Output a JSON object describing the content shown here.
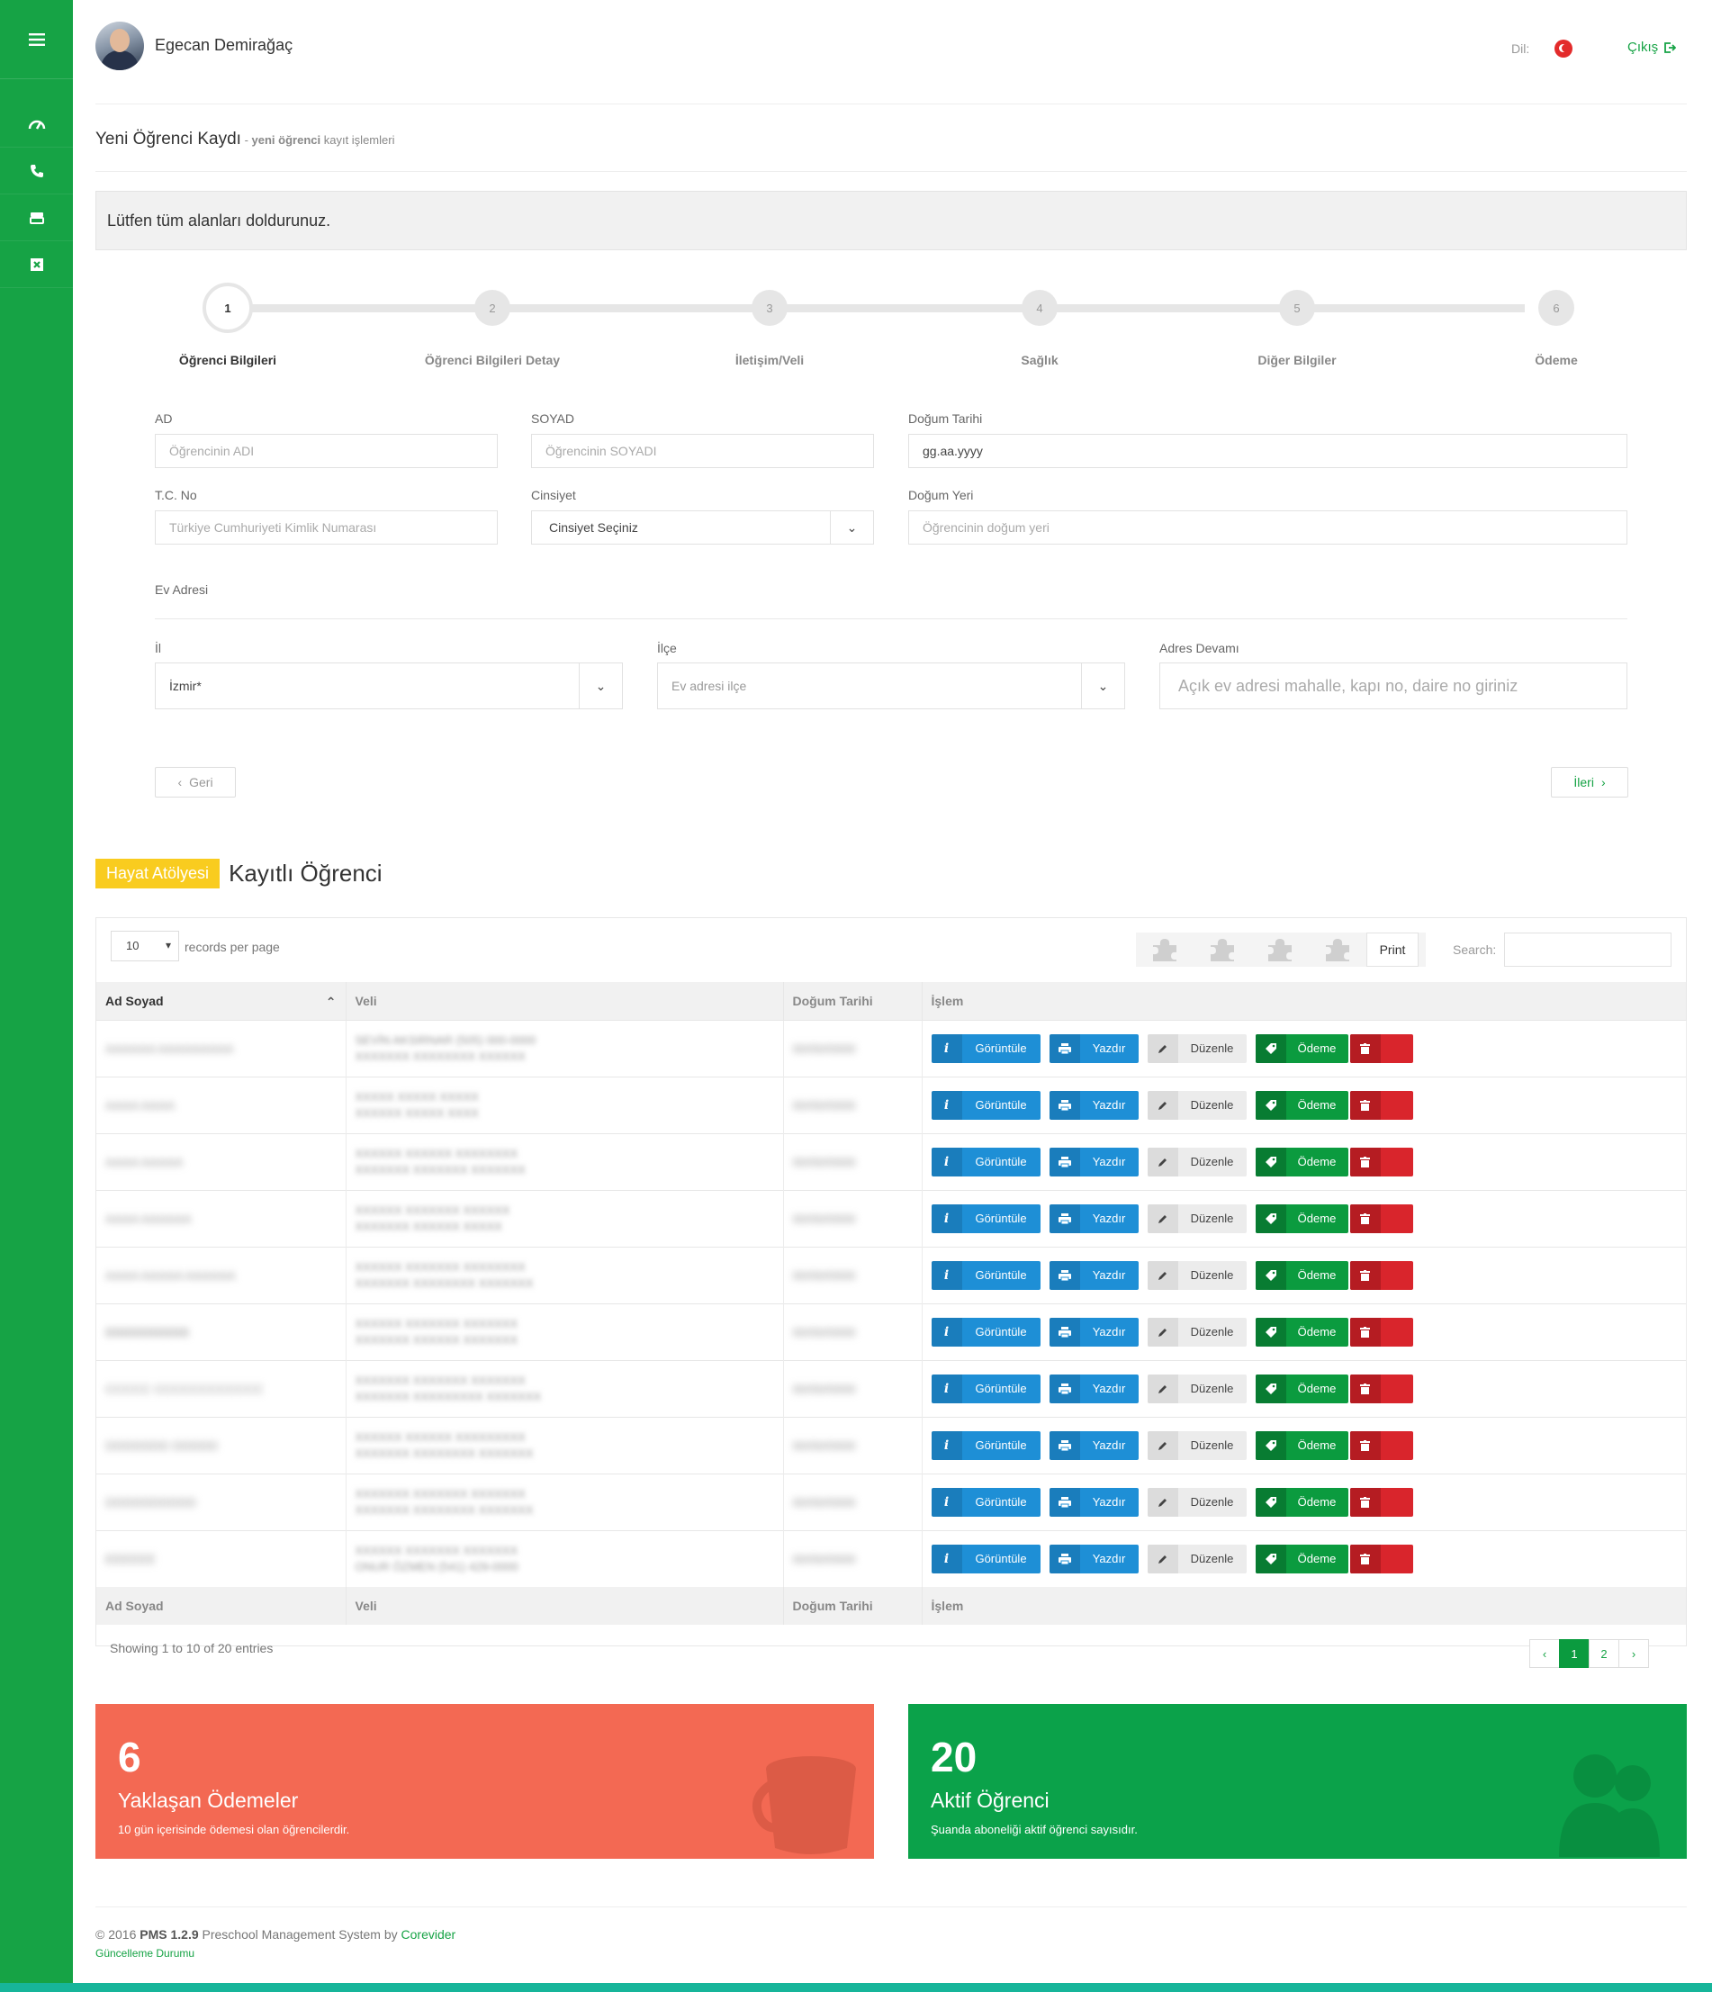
{
  "header": {
    "user_name": "Egecan Demirağaç",
    "lang_label": "Dil:",
    "logout_label": "Çıkış"
  },
  "page": {
    "title": "Yeni Öğrenci Kaydı",
    "subtitle_sep": " - ",
    "subtitle_bold": "yeni öğrenci",
    "subtitle_rest": " kayıt işlemleri",
    "notice": "Lütfen tüm alanları doldurunuz."
  },
  "wizard": {
    "steps": [
      {
        "num": "1",
        "label": "Öğrenci Bilgileri",
        "active": true
      },
      {
        "num": "2",
        "label": "Öğrenci Bilgileri Detay",
        "active": false
      },
      {
        "num": "3",
        "label": "İletişim/Veli",
        "active": false
      },
      {
        "num": "4",
        "label": "Sağlık",
        "active": false
      },
      {
        "num": "5",
        "label": "Diğer Bilgiler",
        "active": false
      },
      {
        "num": "6",
        "label": "Ödeme",
        "active": false
      }
    ]
  },
  "form": {
    "ad_label": "AD",
    "ad_placeholder": "Öğrencinin ADI",
    "soyad_label": "SOYAD",
    "soyad_placeholder": "Öğrencinin SOYADI",
    "dogum_tarihi_label": "Doğum Tarihi",
    "dogum_tarihi_value": "gg.aa.yyyy",
    "tc_label": "T.C. No",
    "tc_placeholder": "Türkiye Cumhuriyeti Kimlik Numarası",
    "cinsiyet_label": "Cinsiyet",
    "cinsiyet_value": "Cinsiyet Seçiniz",
    "dogum_yeri_label": "Doğum Yeri",
    "dogum_yeri_placeholder": "Öğrencinin doğum yeri",
    "ev_adresi_label": "Ev Adresi",
    "il_label": "İl",
    "il_value": "İzmir*",
    "ilce_label": "İlçe",
    "ilce_value": "Ev adresi ilçe",
    "adres_label": "Adres Devamı",
    "adres_placeholder": "Açık ev adresi mahalle, kapı no, daire no giriniz",
    "back_label": "Geri",
    "next_label": "İleri"
  },
  "section": {
    "badge": "Hayat Atölyesi",
    "title": "Kayıtlı Öğrenci"
  },
  "table": {
    "length_value": "10",
    "length_text": "records per page",
    "print_label": "Print",
    "search_label": "Search:",
    "columns": [
      "Ad Soyad",
      "Veli",
      "Doğum Tarihi",
      "İşlem"
    ],
    "actions": {
      "view": "Görüntüle",
      "print": "Yazdır",
      "edit": "Düzenle",
      "pay": "Ödeme",
      "delete": "sil"
    },
    "rows": [
      {
        "name": "AAAAAA AAAAAAAAA",
        "veli1": "SEVİN AKSIRNAR (505) 000-0000",
        "veli2": "XXXXXXX XXXXXXXX XXXXXX",
        "dob": "00/00/0000"
      },
      {
        "name": "AAAA AAAA",
        "veli1": "XXXXX XXXXX XXXXX",
        "veli2": "XXXXXX XXXXX XXXX",
        "dob": "00/00/0000"
      },
      {
        "name": "AAAA AAAAA",
        "veli1": "XXXXXX XXXXXX XXXXXXXX",
        "veli2": "XXXXXXX XXXXXXX XXXXXXX",
        "dob": "00/00/0000"
      },
      {
        "name": "AAAA AAAAAA",
        "veli1": "XXXXXX XXXXXXX XXXXXX",
        "veli2": "XXXXXXX XXXXXX XXXXX",
        "dob": "00/00/0000"
      },
      {
        "name": "AAAA AAAAA AAAAAA",
        "veli1": "XXXXXX XXXXXXX XXXXXXXX",
        "veli2": "XXXXXXX XXXXXXXX XXXXXXX",
        "dob": "00/00/0000"
      },
      {
        "name": "BBBBBBBBBB",
        "veli1": "XXXXXX XXXXXXX XXXXXXX",
        "veli2": "XXXXXXX XXXXXX XXXXXXX",
        "dob": "00/00/0000"
      },
      {
        "name": "CCCCC CCCCCCCCCCCC",
        "veli1": "XXXXXXX XXXXXXX XXXXXXX",
        "veli2": "XXXXXXX XXXXXXXXX XXXXXXX",
        "dob": "00/00/0000"
      },
      {
        "name": "DDDDDDD DDDDD",
        "veli1": "XXXXXX XXXXXX XXXXXXXXX",
        "veli2": "XXXXXXX XXXXXXXX XXXXXXX",
        "dob": "00/00/0000"
      },
      {
        "name": "DDDDDDDDDD",
        "veli1": "XXXXXXX XXXXXXX XXXXXXX",
        "veli2": "XXXXXXX XXXXXXXX XXXXXXX",
        "dob": "00/00/0000"
      },
      {
        "name": "EEEEEE",
        "veli1": "XXXXXX XXXXXXX XXXXXXX",
        "veli2": "ONUR ÖZMEN (541) 429-0000",
        "dob": "00/00/0000"
      }
    ],
    "info": "Showing 1 to 10 of 20 entries",
    "pages": [
      "1",
      "2"
    ],
    "current_page": "1"
  },
  "stats": {
    "red": {
      "num": "6",
      "label": "Yaklaşan Ödemeler",
      "desc": "10 gün içerisinde ödemesi olan öğrencilerdir."
    },
    "green": {
      "num": "20",
      "label": "Aktif Öğrenci",
      "desc": "Şuanda aboneliği aktif öğrenci sayısıdır."
    }
  },
  "footer": {
    "copy": "© 2016 ",
    "product": "PMS 1.2.9",
    "desc": " Preschool Management System by ",
    "company": "Corevider",
    "update": "Güncelleme Durumu"
  },
  "colors": {
    "brand_green": "#16a345",
    "accent_yellow": "#f9cc1f",
    "stat_red": "#f36953",
    "stat_green": "#0ba24a",
    "action_blue": "#1e8fd6",
    "action_red": "#d9252c"
  }
}
